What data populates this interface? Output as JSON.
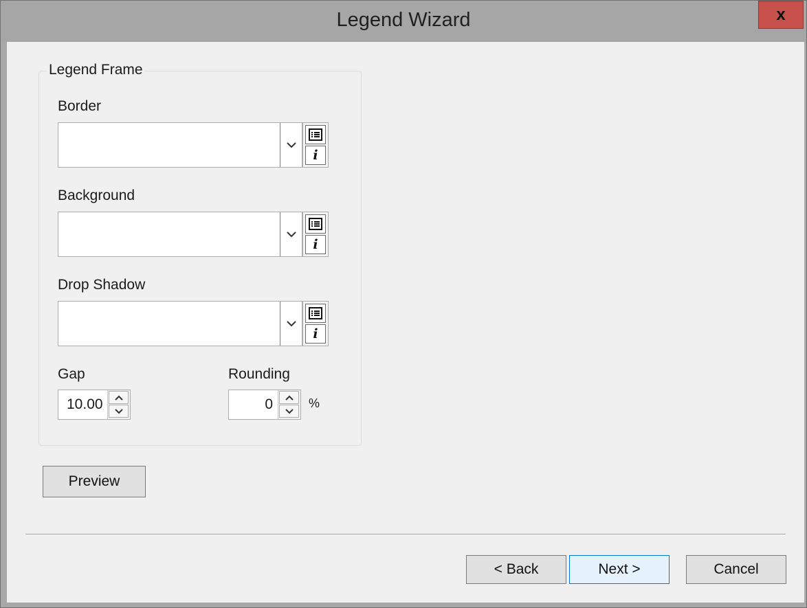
{
  "window": {
    "title": "Legend Wizard",
    "close_label": "x"
  },
  "group": {
    "title": "Legend Frame"
  },
  "border": {
    "label": "Border",
    "value": ""
  },
  "background": {
    "label": "Background",
    "value": ""
  },
  "drop_shadow": {
    "label": "Drop Shadow",
    "value": ""
  },
  "gap": {
    "label": "Gap",
    "value": "10.00"
  },
  "rounding": {
    "label": "Rounding",
    "value": "0",
    "unit": "%"
  },
  "buttons": {
    "preview": "Preview",
    "back": "< Back",
    "next": "Next >",
    "cancel": "Cancel"
  },
  "icons": [
    "chevron-down-icon",
    "list-icon",
    "info-icon",
    "spin-up-icon",
    "spin-down-icon"
  ],
  "colors": {
    "close_button": "#c7504a",
    "primary_border": "#0078d7",
    "primary_fill": "#e5f1fb"
  }
}
